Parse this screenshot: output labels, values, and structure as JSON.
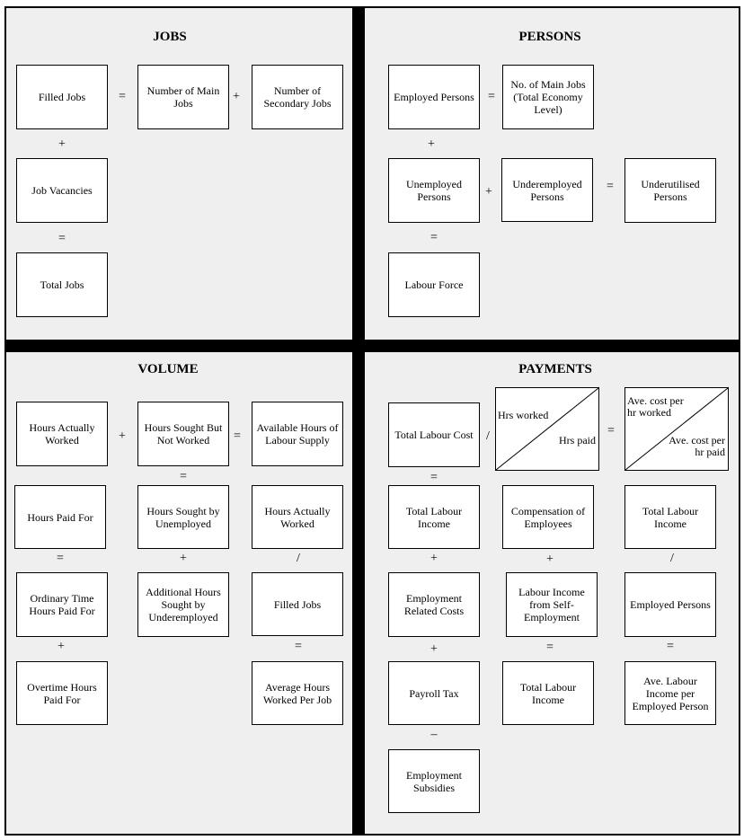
{
  "jobs": {
    "title": "JOBS",
    "filled_jobs": "Filled Jobs",
    "main_jobs": "Number of Main Jobs",
    "secondary_jobs": "Number of Secondary Jobs",
    "job_vacancies": "Job Vacancies",
    "total_jobs": "Total Jobs",
    "ops": {
      "eq1": "=",
      "plus1": "+",
      "plus2": "+",
      "eq2": "="
    }
  },
  "persons": {
    "title": "PERSONS",
    "employed": "Employed Persons",
    "main_jobs_total": "No. of Main Jobs (Total Economy Level)",
    "unemployed": "Unemployed Persons",
    "underemployed": "Underemployed Persons",
    "underutilised": "Underutilised Persons",
    "labour_force": "Labour Force",
    "ops": {
      "eq1": "=",
      "plus1": "+",
      "plus2": "+",
      "eq2": "=",
      "eq3": "="
    }
  },
  "volume": {
    "title": "VOLUME",
    "hours_worked": "Hours Actually Worked",
    "hours_sought_not_worked": "Hours Sought But Not Worked",
    "available_hours": "Available Hours of Labour Supply",
    "hours_paid_for": "Hours Paid For",
    "hours_sought_unemployed": "Hours Sought by Unemployed",
    "hours_worked_2": "Hours Actually Worked",
    "ordinary_time": "Ordinary Time Hours Paid For",
    "additional_hours": "Additional Hours Sought by Underemployed",
    "filled_jobs": "Filled Jobs",
    "overtime": "Overtime Hours Paid For",
    "avg_hours": "Average Hours Worked Per Job",
    "ops": {
      "plus1": "+",
      "eq1": "=",
      "eq2": "=",
      "eq3": "=",
      "plus2": "+",
      "div1": "/",
      "plus3": "+",
      "eq4": "="
    }
  },
  "payments": {
    "title": "PAYMENTS",
    "total_labour_cost": "Total Labour Cost",
    "hrs_worked": "Hrs worked",
    "hrs_paid": "Hrs paid",
    "ave_cost_worked": "Ave. cost per hr worked",
    "ave_cost_paid": "Ave. cost per hr paid",
    "total_labour_income": "Total Labour Income",
    "compensation": "Compensation of Employees",
    "total_labour_income_2": "Total Labour Income",
    "employment_related": "Employment Related Costs",
    "labour_income_self": "Labour Income from Self-Employment",
    "employed_persons": "Employed Persons",
    "payroll_tax": "Payroll Tax",
    "total_labour_income_3": "Total Labour Income",
    "ave_labour_income": "Ave. Labour Income per Employed Person",
    "employment_subsidies": "Employment Subsidies",
    "ops": {
      "div1": "/",
      "eq1": "=",
      "eq2": "=",
      "plus1": "+",
      "plus2": "+",
      "div2": "/",
      "plus3": "+",
      "eq3": "=",
      "eq4": "=",
      "minus1": "–"
    }
  }
}
